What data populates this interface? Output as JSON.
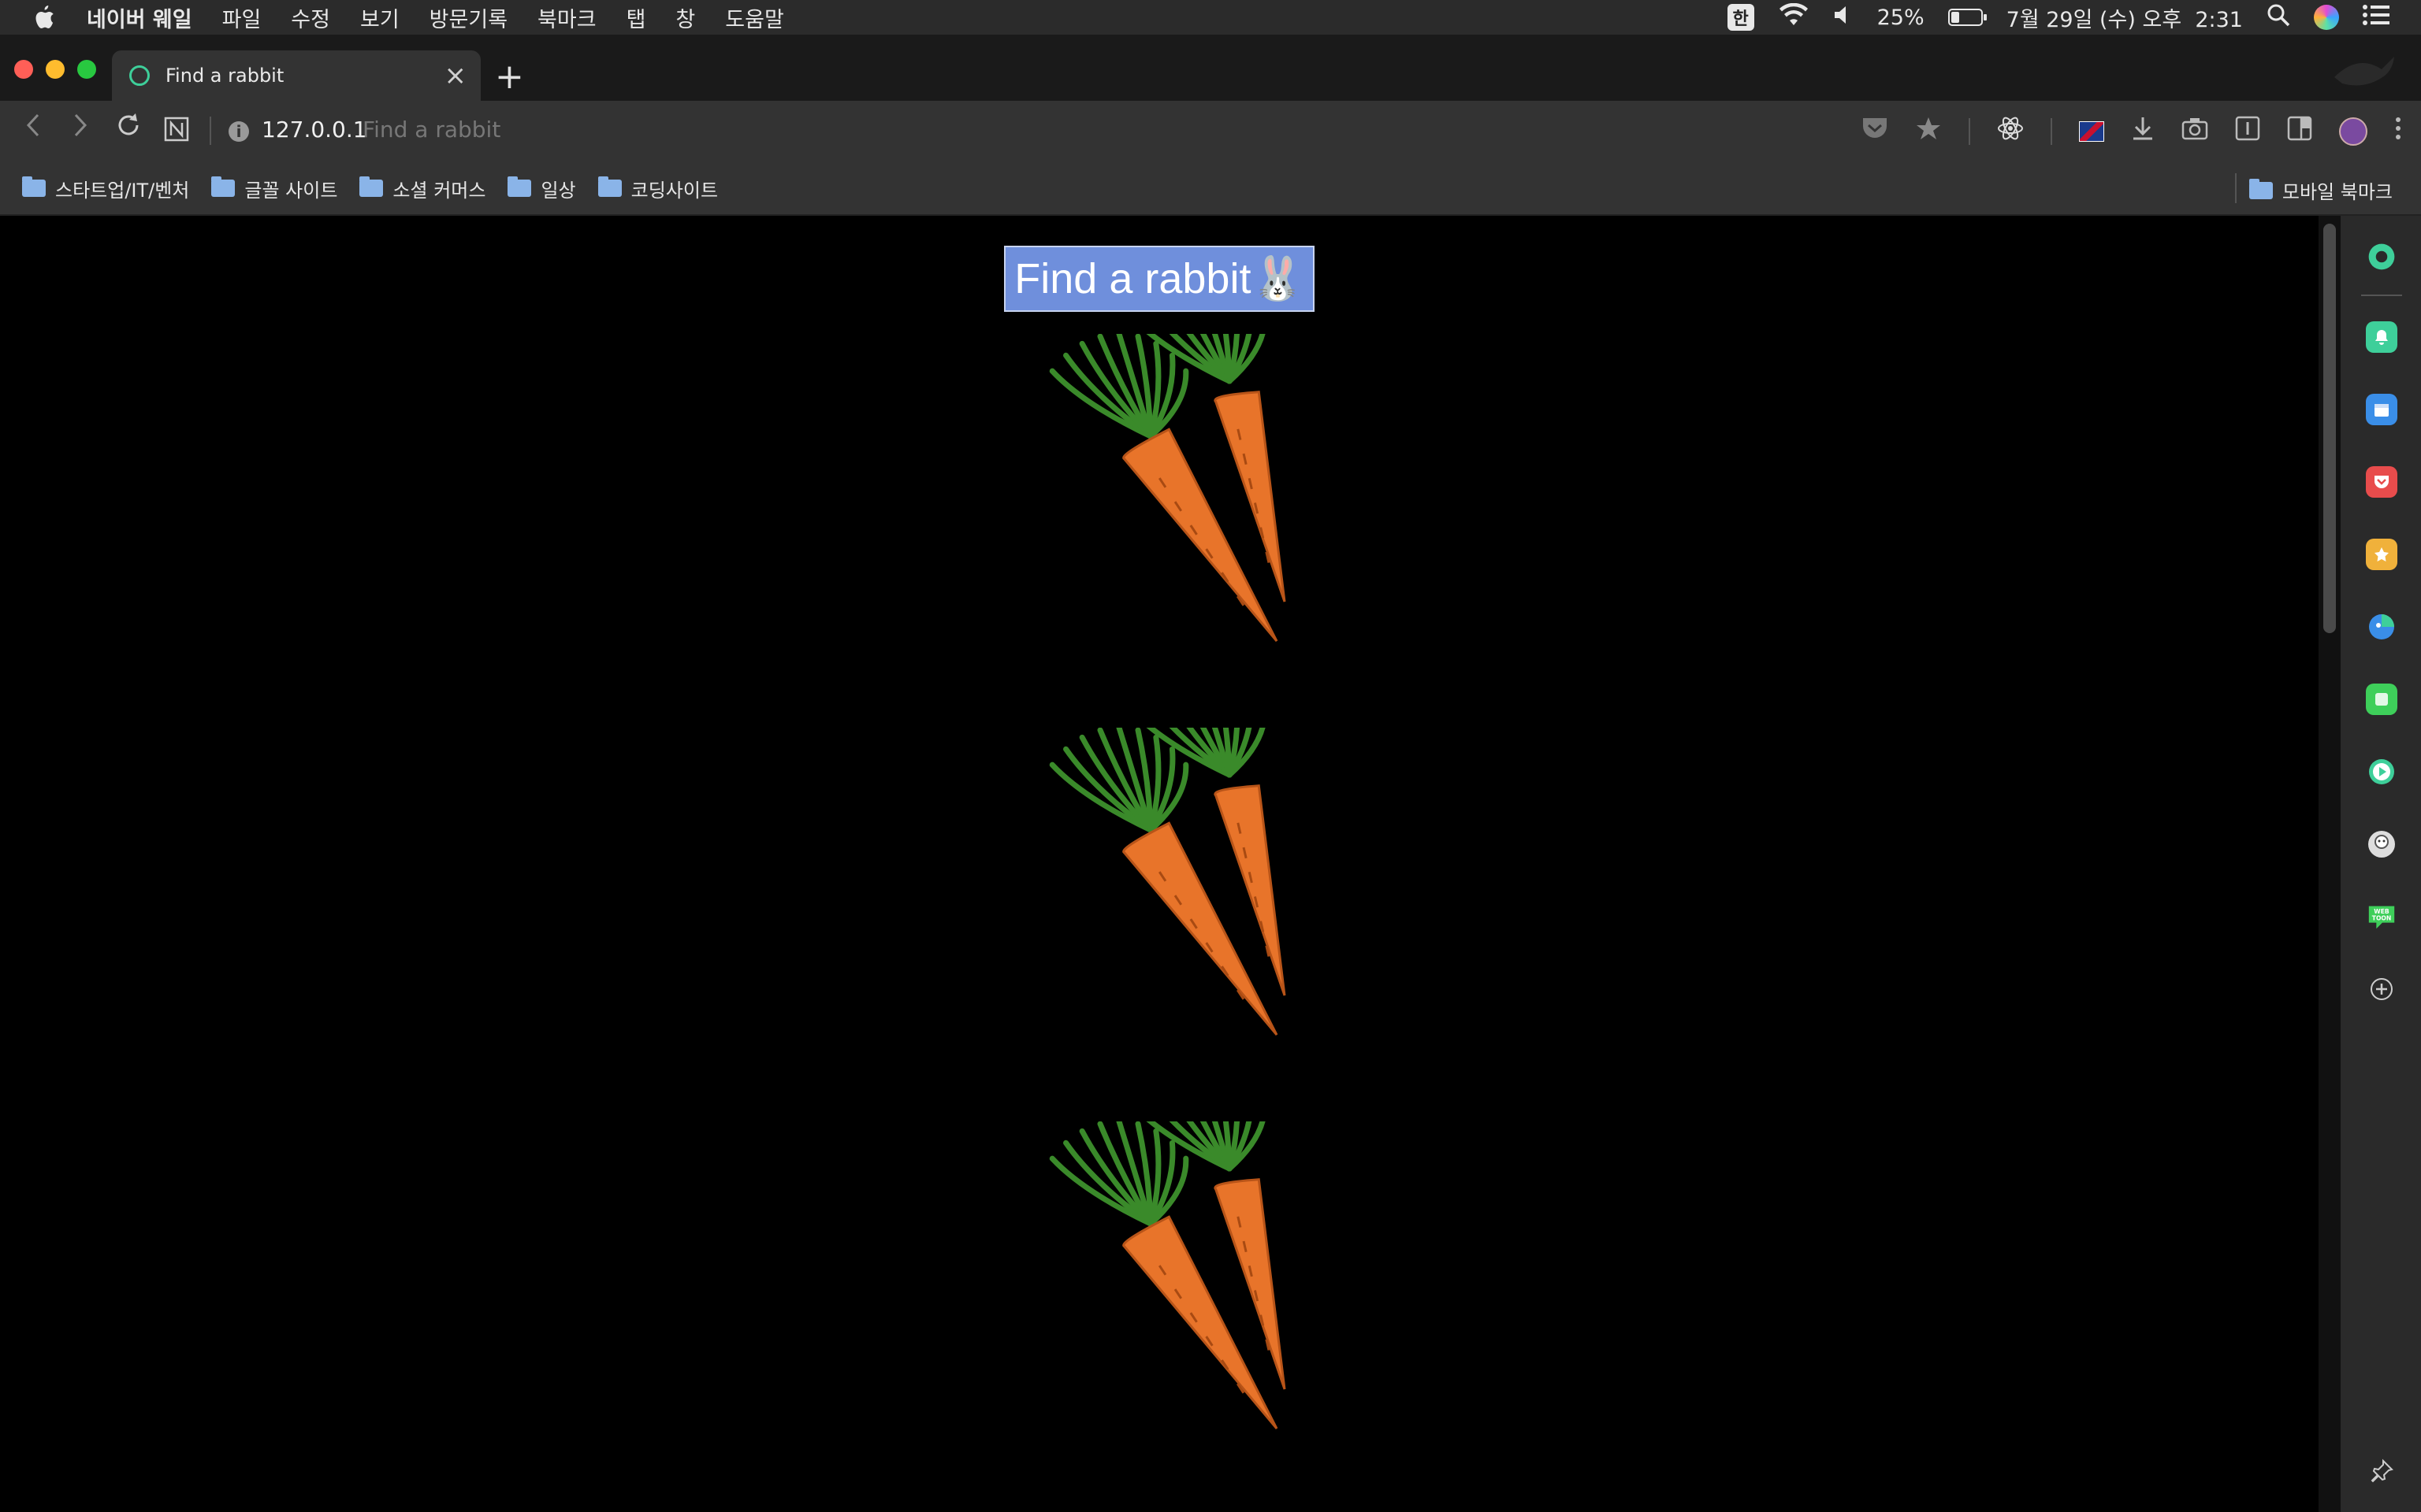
{
  "menubar": {
    "app": "네이버 웨일",
    "items": [
      "파일",
      "수정",
      "보기",
      "방문기록",
      "북마크",
      "탭",
      "창",
      "도움말"
    ],
    "ime": "한",
    "battery_percent": "25%",
    "battery_level": 0.25,
    "datetime": "7월 29일 (수) 오후  2:31"
  },
  "tab": {
    "title": "Find a rabbit",
    "close": "×",
    "new_tab": "+"
  },
  "address": {
    "url": "127.0.0.1",
    "page_title": "Find a rabbit"
  },
  "bookmarks": {
    "items": [
      "스타트업/IT/벤처",
      "글꼴 사이트",
      "소셜 커머스",
      "일상",
      "코딩사이트"
    ],
    "mobile": "모바일 북마크"
  },
  "content": {
    "button_label": "Find a rabbit🐰",
    "carrot_count": 3
  },
  "colors": {
    "button_bg": "#6f8fdc",
    "carrot": "#e8742a",
    "leaf": "#3a8a2a",
    "accent": "#3ecf9a"
  }
}
